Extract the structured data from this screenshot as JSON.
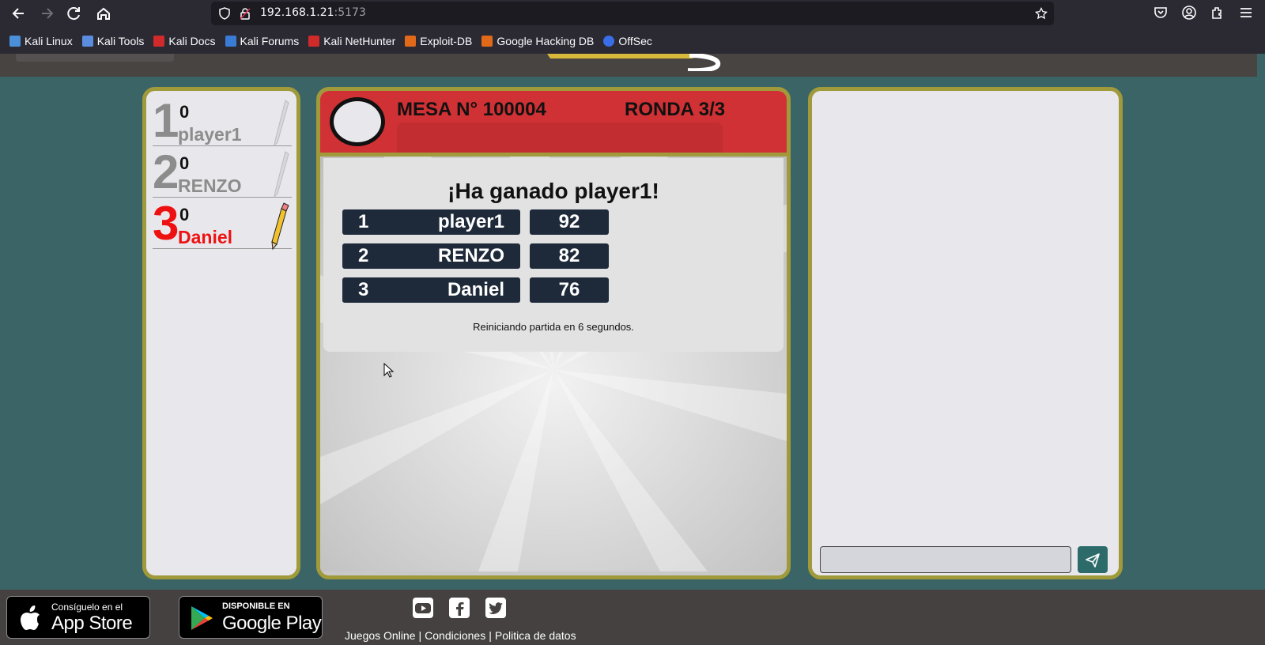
{
  "browser": {
    "url_host": "192.168.1.21",
    "url_port": ":5173",
    "bookmarks": [
      {
        "label": "Kali Linux",
        "color": "#4a90d9"
      },
      {
        "label": "Kali Tools",
        "color": "#5a8de0"
      },
      {
        "label": "Kali Docs",
        "color": "#d12a2a"
      },
      {
        "label": "Kali Forums",
        "color": "#3a7bd5"
      },
      {
        "label": "Kali NetHunter",
        "color": "#d12a2a"
      },
      {
        "label": "Exploit-DB",
        "color": "#e06a1a"
      },
      {
        "label": "Google Hacking DB",
        "color": "#e06a1a"
      },
      {
        "label": "OffSec",
        "color": "#3a6ee8"
      }
    ]
  },
  "players": [
    {
      "rank": "1",
      "score": "0",
      "name": "player1",
      "drawing": false
    },
    {
      "rank": "2",
      "score": "0",
      "name": "RENZO",
      "drawing": false
    },
    {
      "rank": "3",
      "score": "0",
      "name": "Daniel",
      "drawing": true
    }
  ],
  "game": {
    "mesa": "MESA N° 100004",
    "ronda": "RONDA 3/3",
    "winner_title": "¡Ha ganado player1!",
    "results": [
      {
        "pos": "1",
        "name": "player1",
        "score": "92"
      },
      {
        "pos": "2",
        "name": "RENZO",
        "score": "82"
      },
      {
        "pos": "3",
        "name": "Daniel",
        "score": "76"
      }
    ],
    "restart_text": "Reiniciando partida en 6 segundos."
  },
  "chat": {
    "input_value": "",
    "input_placeholder": ""
  },
  "footer": {
    "appstore_small": "Consíguelo en el",
    "appstore_big": "App Store",
    "gplay_small": "DISPONIBLE EN",
    "gplay_big": "Google Play",
    "links": [
      "Juegos Online",
      "Condiciones",
      "Politica de datos"
    ],
    "social_icons": [
      "youtube-icon",
      "facebook-icon",
      "twitter-icon"
    ]
  },
  "colors": {
    "page_bg": "#3a6466",
    "panel_border": "#a09a3a",
    "game_header": "#d03134",
    "active_player": "#ee1111",
    "result_bg": "#1e2a3a"
  }
}
